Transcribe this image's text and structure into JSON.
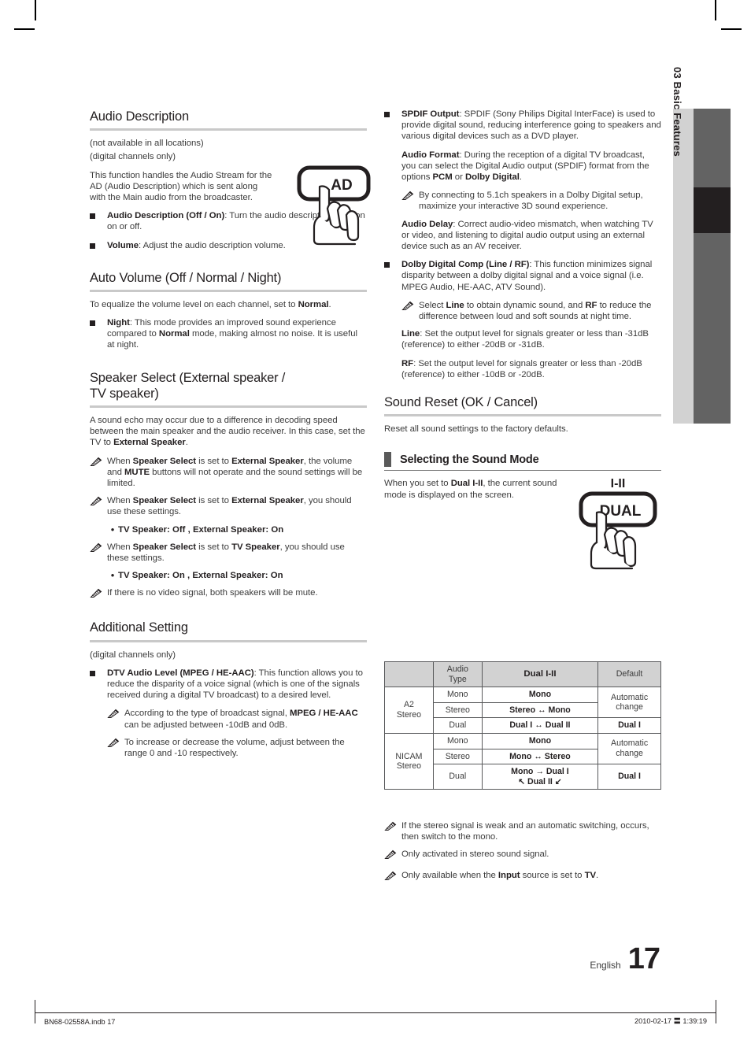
{
  "page": {
    "language_label": "English",
    "page_number": "17",
    "side_tab": {
      "chapter": "03",
      "title": "Basic Features",
      "combined": "03   Basic Features"
    },
    "footer": {
      "left": "BN68-02558A.indb   17",
      "right": "2010-02-17   〓 1:39:19"
    }
  },
  "left_column": {
    "audio_description": {
      "heading": "Audio Description",
      "note_locations": "(not available in all locations)",
      "note_digital": "(digital channels only)",
      "intro": "This function handles the Audio Stream for the AD (Audio Description) which is sent along with the Main audio from the broadcaster.",
      "button_label": "AD",
      "bullets": [
        {
          "bold": "Audio Description (Off / On)",
          "rest": ": Turn the audio description function on or off."
        },
        {
          "bold": "Volume",
          "rest": ": Adjust the audio description volume."
        }
      ]
    },
    "auto_volume": {
      "heading": "Auto Volume (Off / Normal / Night)",
      "intro_a": "To equalize the volume level on each channel, set to ",
      "intro_b": "Normal",
      "intro_c": ".",
      "bullet_bold": "Night",
      "bullet_1": ": This mode provides an improved sound experience compared to ",
      "bullet_bold_2": "Normal",
      "bullet_2": " mode, making almost no noise. It is useful at night."
    },
    "speaker_select": {
      "heading_line1": "Speaker Select (External speaker /",
      "heading_line2": "TV speaker)",
      "intro_a": "A sound echo may occur due to a difference in decoding speed between the main speaker and the audio receiver. In this case, set the TV to ",
      "intro_b": "External Speaker",
      "intro_c": ".",
      "notes": [
        {
          "parts": [
            "When ",
            "Speaker Select",
            " is set to ",
            "External Speaker",
            ", the volume and ",
            "MUTE",
            " buttons will not operate and the sound settings will be limited."
          ]
        },
        {
          "parts": [
            "When ",
            "Speaker Select",
            " is set to ",
            "External Speaker",
            ", you should use these settings."
          ]
        },
        {
          "parts": [
            "When ",
            "Speaker Select",
            " is set to ",
            "TV Speaker",
            ", you should use these settings."
          ]
        },
        {
          "parts": [
            "If there is no video signal, both speakers will be mute."
          ]
        }
      ],
      "dot_1": "TV Speaker: Off , External Speaker: On",
      "dot_2": "TV Speaker: On , External Speaker: On"
    },
    "additional_setting": {
      "heading": "Additional Setting",
      "note_digital": "(digital channels only)",
      "bullet_bold": "DTV Audio Level (MPEG / HE-AAC)",
      "bullet_rest": ": This function allows you to reduce the disparity of a voice signal (which is one of the signals received during a digital TV broadcast) to a desired level.",
      "note_1_a": "According to the type of broadcast signal, ",
      "note_1_b": "MPEG / HE-AAC",
      "note_1_c": " can be adjusted between -10dB and 0dB.",
      "note_2": "To increase or decrease the volume, adjust between the range 0 and -10 respectively."
    }
  },
  "right_column": {
    "spdif": {
      "bullet_bold": "SPDIF Output",
      "bullet_rest": ": SPDIF (Sony Philips Digital InterFace) is used to provide digital sound, reducing interference going to speakers and various digital devices such as a DVD player.",
      "audio_format_bold": "Audio Format",
      "audio_format_a": ": During the reception of a digital TV broadcast, you can select the Digital Audio output (SPDIF) format from the options ",
      "audio_format_b": "PCM",
      "audio_format_c": " or ",
      "audio_format_d": "Dolby Digital",
      "audio_format_e": ".",
      "note": "By connecting to 5.1ch speakers in a Dolby Digital setup, maximize your interactive 3D sound experience.",
      "audio_delay_bold": "Audio Delay",
      "audio_delay_rest": ": Correct audio-video mismatch, when watching TV or video, and listening to digital audio output using an external device such as an AV receiver."
    },
    "dolby_comp": {
      "bullet_bold": "Dolby Digital Comp (Line / RF)",
      "bullet_rest": ": This function minimizes signal disparity between a dolby digital signal and a voice signal (i.e. MPEG Audio, HE-AAC, ATV Sound).",
      "note_a": "Select ",
      "note_b": "Line",
      "note_c": " to obtain dynamic sound, and ",
      "note_d": "RF",
      "note_e": " to reduce the difference between loud and soft sounds at night time.",
      "line_bold": "Line",
      "line_rest": ": Set the output level for signals greater or less than -31dB (reference) to either -20dB or -31dB.",
      "rf_bold": "RF",
      "rf_rest": ": Set the output level for signals greater or less than -20dB (reference) to either -10dB or -20dB."
    },
    "sound_reset": {
      "heading": "Sound Reset (OK / Cancel)",
      "text": "Reset all sound settings to the factory defaults."
    },
    "sound_mode": {
      "heading": "Selecting the Sound Mode",
      "intro_a": "When you set to ",
      "intro_b": "Dual I-II",
      "intro_c": ", the current sound mode is displayed on the screen.",
      "button_top_label": "I-II",
      "button_label": "DUAL"
    },
    "mode_table": {
      "headers": [
        "",
        "Audio Type",
        "Dual I-II",
        "Default"
      ],
      "rows": [
        {
          "group": "A2 Stereo",
          "audio_type": "Mono",
          "dual": "Mono",
          "default": "Automatic change"
        },
        {
          "group": "A2 Stereo",
          "audio_type": "Stereo",
          "dual": "Stereo ↔ Mono",
          "default": "Automatic change"
        },
        {
          "group": "A2 Stereo",
          "audio_type": "Dual",
          "dual": "Dual I ↔ Dual II",
          "default": "Dual I"
        },
        {
          "group": "NICAM Stereo",
          "audio_type": "Mono",
          "dual": "Mono",
          "default": "Automatic change"
        },
        {
          "group": "NICAM Stereo",
          "audio_type": "Stereo",
          "dual": "Mono ↔ Stereo",
          "default": "Automatic change"
        },
        {
          "group": "NICAM Stereo",
          "audio_type": "Dual",
          "dual": "Mono → Dual I",
          "dual_line2": "↖ Dual II ↙",
          "default": "Dual I"
        }
      ],
      "group_a2_line1": "A2",
      "group_a2_line2": "Stereo",
      "group_nicam_line1": "NICAM",
      "group_nicam_line2": "Stereo",
      "header_audio_line1": "Audio",
      "header_audio_line2": "Type",
      "default_auto_line1": "Automatic",
      "default_auto_line2": "change"
    },
    "table_notes": [
      "If the stereo signal is weak and an automatic switching, occurs, then switch to the mono.",
      "Only activated in stereo sound signal.",
      "Only available when the Input source is set to TV."
    ],
    "table_note_3_parts": [
      "Only available when the ",
      "Input",
      " source is set to ",
      "TV",
      "."
    ]
  }
}
